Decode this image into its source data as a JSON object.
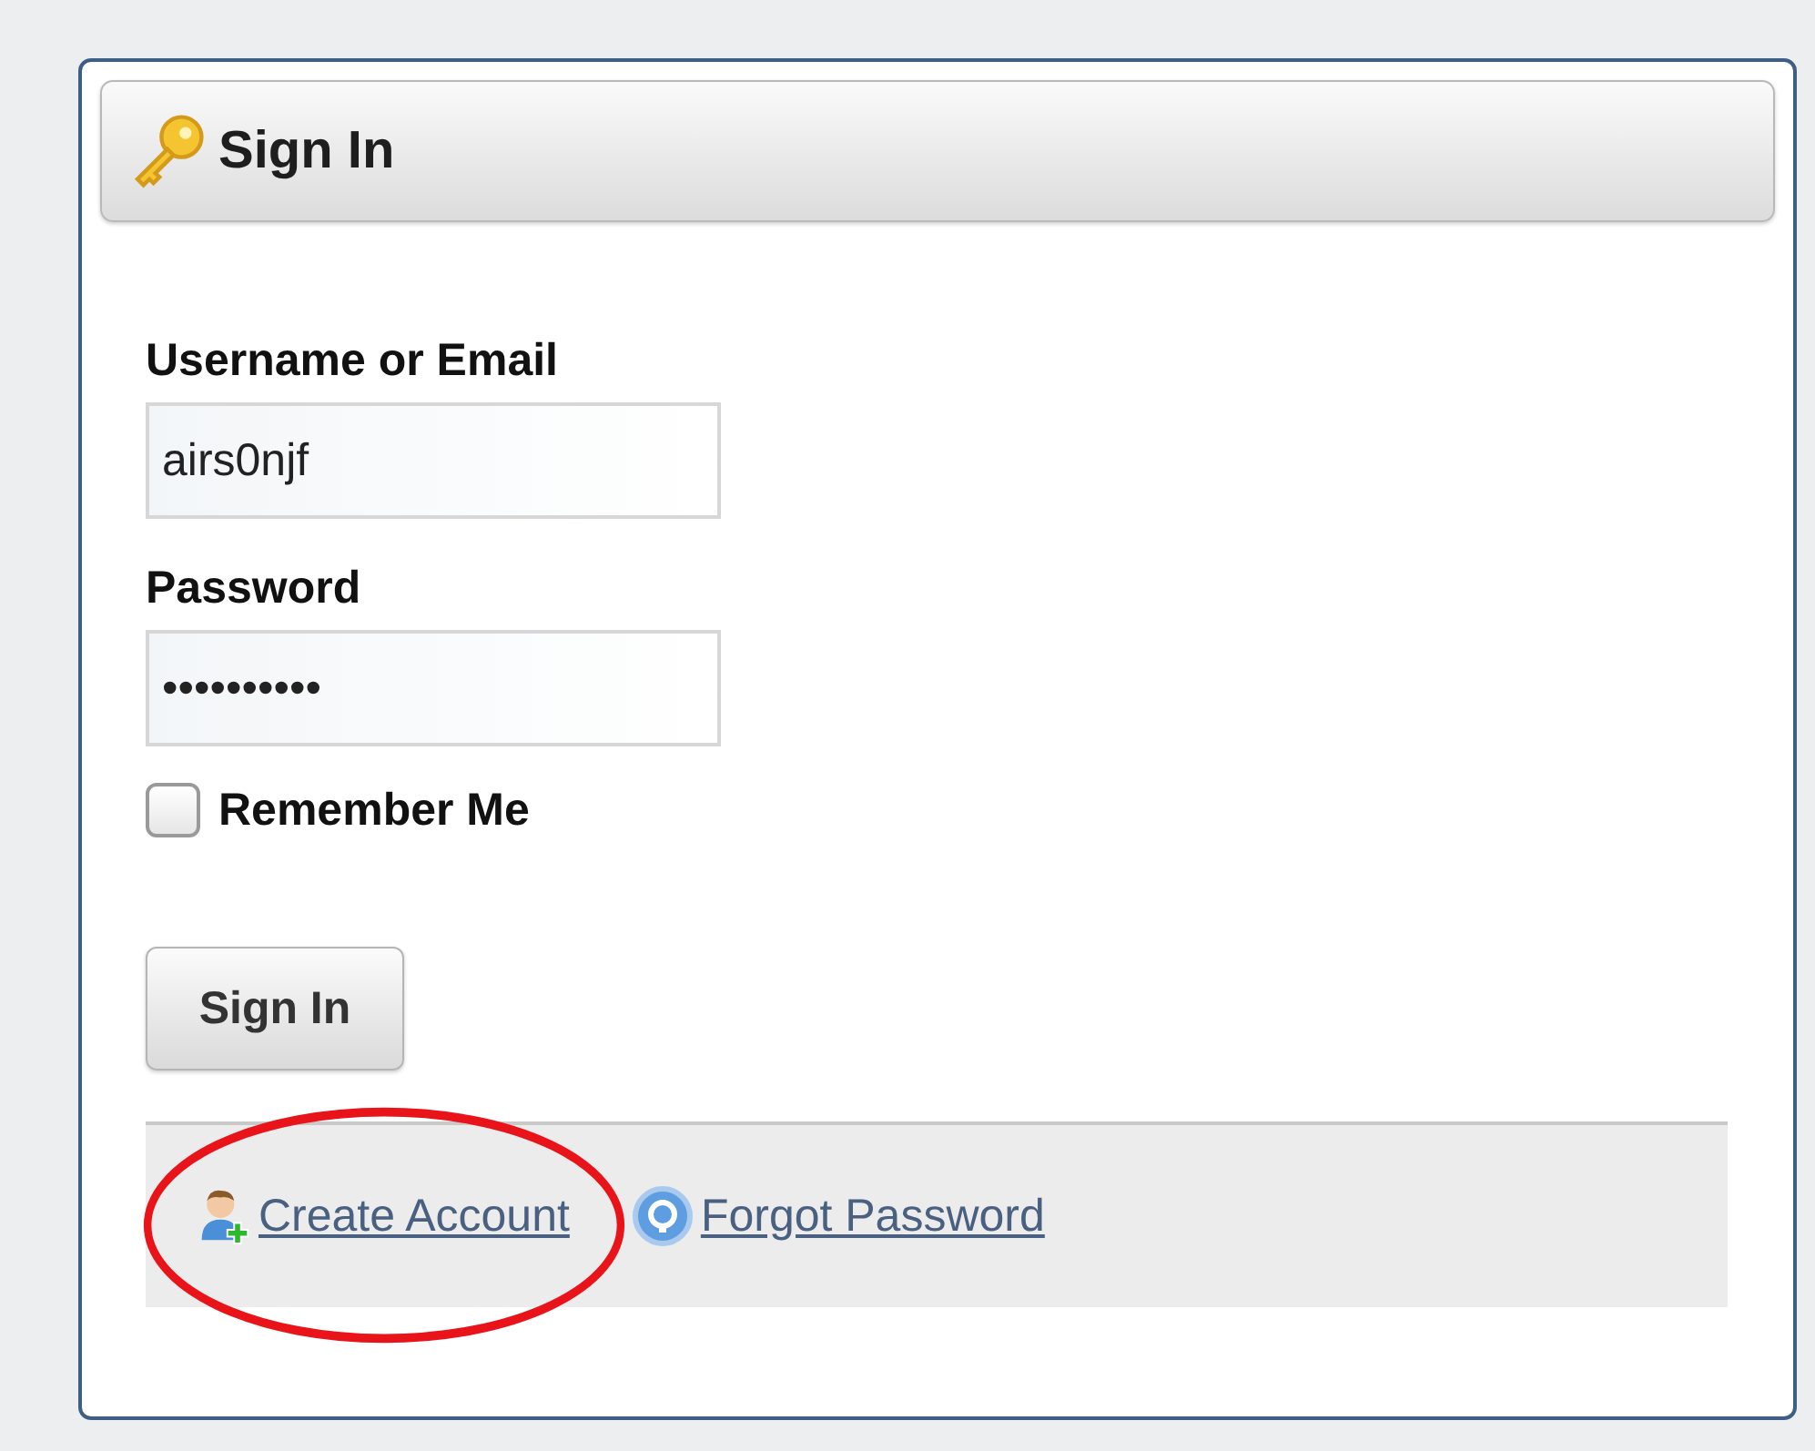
{
  "panel": {
    "title": "Sign In"
  },
  "fields": [
    {
      "label": "Username or Email",
      "value": "airs0njf"
    },
    {
      "label": "Password",
      "value": "••••••••••"
    }
  ],
  "remember": {
    "label": "Remember Me",
    "checked": false
  },
  "submit": "Sign In",
  "links": [
    {
      "kind": "create",
      "label": "Create Account",
      "circled": true
    },
    {
      "kind": "help",
      "label": "Forgot Password",
      "circled": false
    }
  ]
}
